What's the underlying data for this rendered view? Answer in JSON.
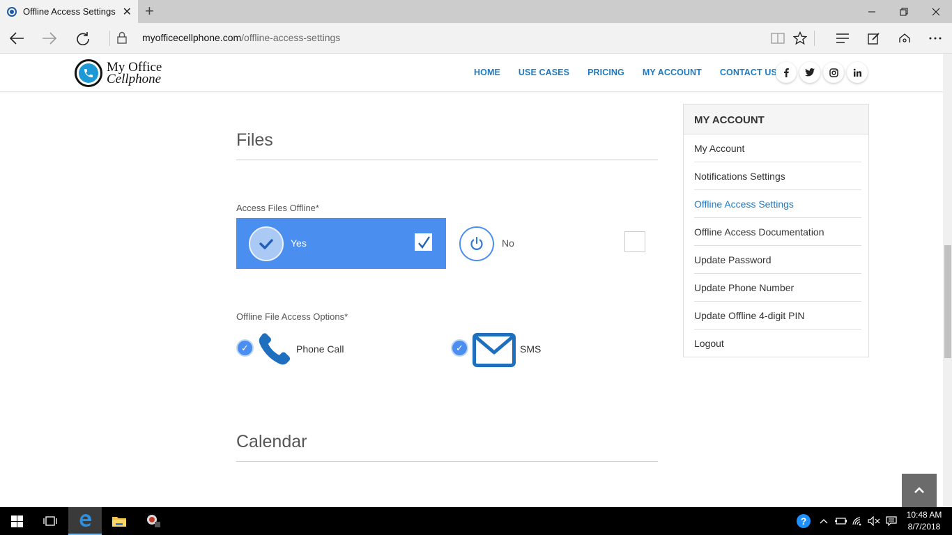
{
  "browser": {
    "tab_title": "Offline Access Settings -",
    "url_domain": "myofficecellphone.com",
    "url_path": "/offline-access-settings"
  },
  "site": {
    "logo_line1": "My Office",
    "logo_line2": "Cellphone",
    "nav": [
      "HOME",
      "USE CASES",
      "PRICING",
      "MY ACCOUNT",
      "CONTACT US"
    ],
    "social": [
      "f",
      "t",
      "ig",
      "in"
    ]
  },
  "main": {
    "files_title": "Files",
    "access_label": "Access Files Offline*",
    "yes_label": "Yes",
    "no_label": "No",
    "yes_selected": true,
    "options_label": "Offline File Access Options*",
    "phone_label": "Phone Call",
    "sms_label": "SMS",
    "phone_checked": true,
    "sms_checked": true,
    "calendar_title": "Calendar"
  },
  "sidebar": {
    "heading": "MY ACCOUNT",
    "items": [
      "My Account",
      "Notifications Settings",
      "Offline Access Settings",
      "Offline Access Documentation",
      "Update Password",
      "Update Phone Number",
      "Update Offline 4-digit PIN",
      "Logout"
    ],
    "active_index": 2
  },
  "taskbar": {
    "time": "10:48 AM",
    "date": "8/7/2018"
  },
  "colors": {
    "accent_blue": "#4a8ef0",
    "link_blue": "#1f7bc1",
    "icon_blue": "#1f6fbf"
  }
}
